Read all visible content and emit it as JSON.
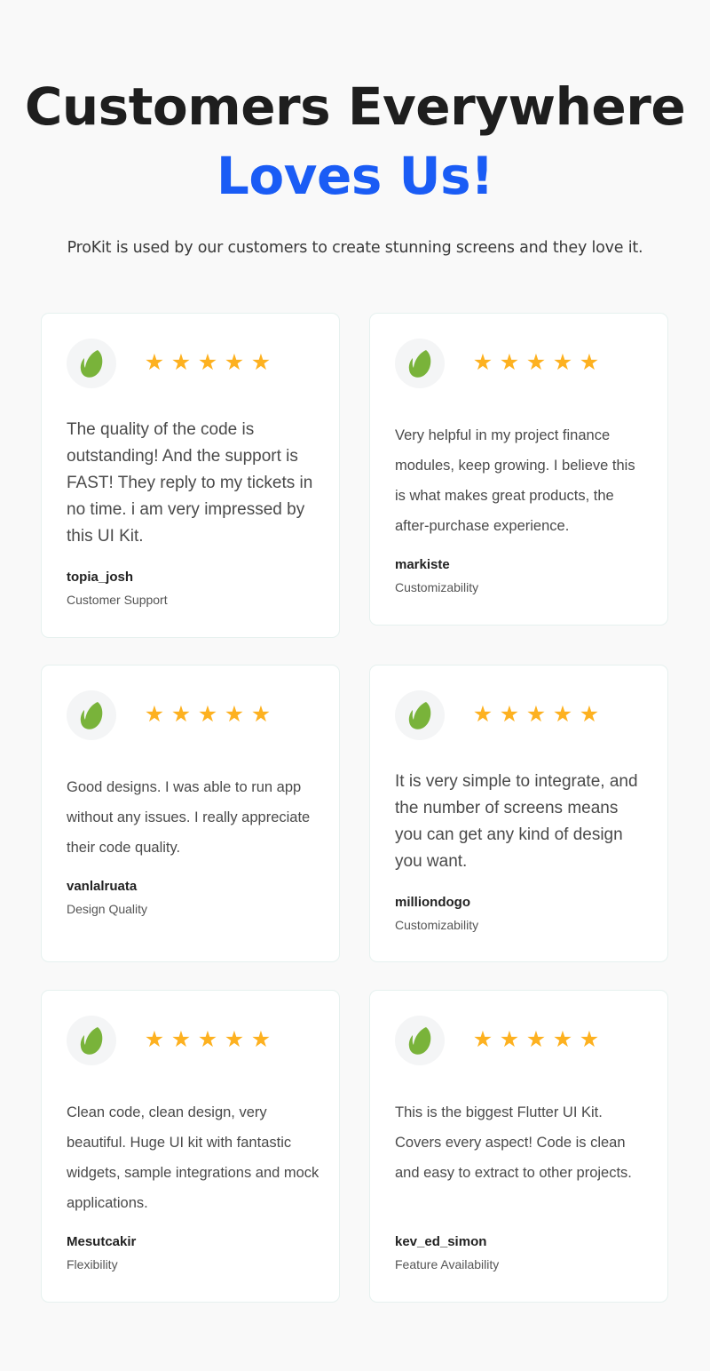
{
  "header": {
    "title_line1": "Customers Everywhere",
    "title_line2": "Loves Us!",
    "subtitle": "ProKit is used by our customers to create stunning screens and they love it.",
    "accent_color": "#1a5cf5"
  },
  "star_color": "#fdb120",
  "logo_icon": "leaf-logo-icon",
  "testimonials": [
    {
      "rating": 5,
      "max_rating": 5,
      "quote": "The quality of the code is outstanding! And the support is FAST! They reply to my tickets in no time. i am very impressed by this UI Kit.",
      "author": "topia_josh",
      "category": "Customer Support"
    },
    {
      "rating": 5,
      "max_rating": 5,
      "quote": "Very helpful in my project finance modules, keep growing. I believe this is what makes great products, the after-purchase experience.",
      "author": "markiste",
      "category": "Customizability"
    },
    {
      "rating": 5,
      "max_rating": 5,
      "quote": "Good designs. I was able to run app without any issues. I really appreciate their code quality.",
      "author": "vanlalruata",
      "category": "Design Quality"
    },
    {
      "rating": 5,
      "max_rating": 5,
      "quote": "It is very simple to integrate, and the number of screens means you can get any kind of design you want.",
      "author": "milliondogo",
      "category": "Customizability"
    },
    {
      "rating": 5,
      "max_rating": 5,
      "quote": "Clean code, clean design, very beautiful. Huge UI kit with fantastic widgets, sample integrations and mock applications.",
      "author": "Mesutcakir",
      "category": "Flexibility"
    },
    {
      "rating": 5,
      "max_rating": 5,
      "quote": "This is the biggest Flutter UI Kit. Covers every aspect! Code is clean and easy to extract to other projects.",
      "author": "kev_ed_simon",
      "category": "Feature Availability"
    }
  ]
}
